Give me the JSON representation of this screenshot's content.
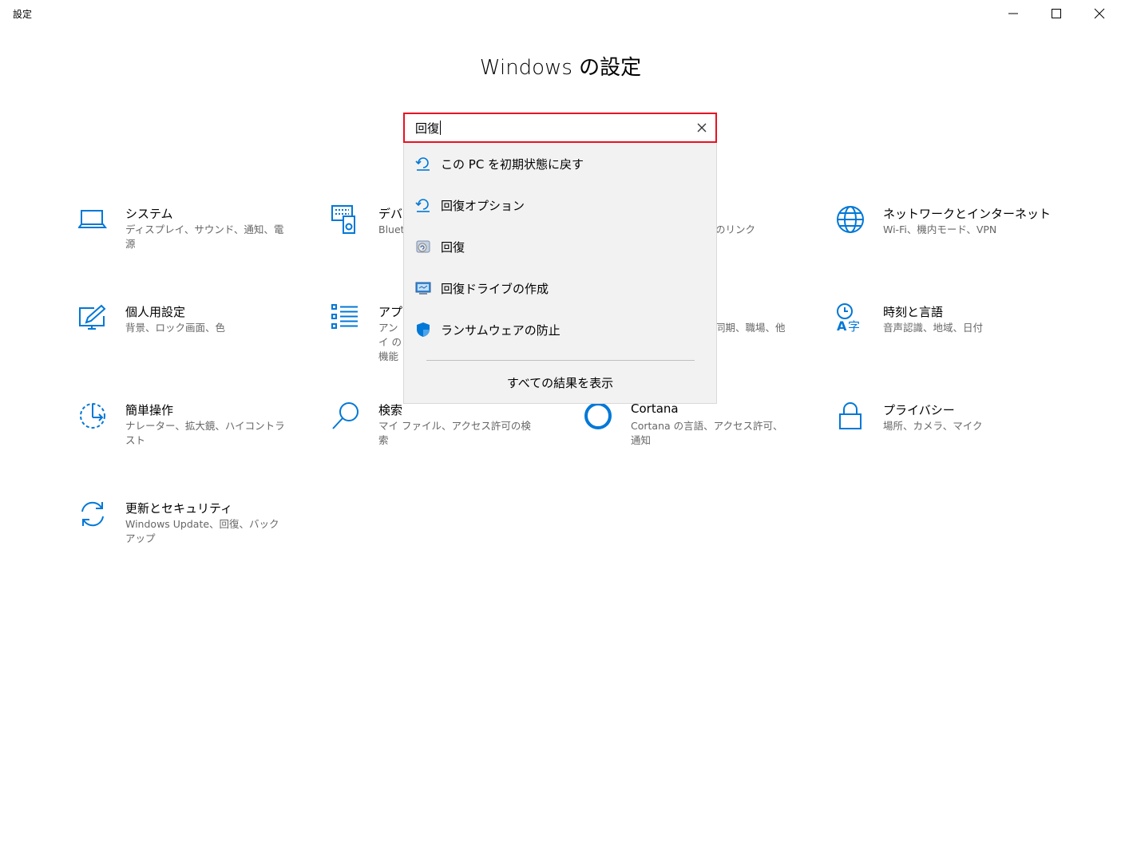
{
  "window": {
    "title": "設定",
    "controls": {
      "minimize_icon": "minimize-icon",
      "maximize_icon": "maximize-icon",
      "close_icon": "close-icon"
    }
  },
  "heading": "Windows の設定",
  "accent_color": "#0078d7",
  "search": {
    "value": "回復",
    "clear_icon": "close-icon",
    "suggestions": [
      {
        "label": "この PC を初期状態に戻す",
        "icon": "recovery-icon"
      },
      {
        "label": "回復オプション",
        "icon": "recovery-icon"
      },
      {
        "label": "回復",
        "icon": "control-panel-recovery-icon"
      },
      {
        "label": "回復ドライブの作成",
        "icon": "recovery-drive-icon"
      },
      {
        "label": "ランサムウェアの防止",
        "icon": "shield-icon"
      }
    ],
    "show_all": "すべての結果を表示"
  },
  "tiles": {
    "system": {
      "title": "システム",
      "desc": "ディスプレイ、サウンド、通知、電源",
      "icon": "laptop-icon"
    },
    "devices": {
      "title": "デバイ",
      "desc": "Bluet",
      "icon": "devices-icon"
    },
    "phone": {
      "desc": "のリンク"
    },
    "network": {
      "title": "ネットワークとインターネット",
      "desc": "Wi-Fi、機内モード、VPN",
      "icon": "globe-icon"
    },
    "personalization": {
      "title": "個人用設定",
      "desc": "背景、ロック画面、色",
      "icon": "paint-icon"
    },
    "apps": {
      "title": "アプリ",
      "desc": "アンイ の機能",
      "icon": "apps-list-icon"
    },
    "accounts": {
      "desc": "同期、職場、他"
    },
    "time": {
      "title": "時刻と言語",
      "desc": "音声認識、地域、日付",
      "icon": "time-language-icon"
    },
    "ease": {
      "title": "簡単操作",
      "desc": "ナレーター、拡大鏡、ハイコントラスト",
      "icon": "ease-of-access-icon"
    },
    "search_tile": {
      "title": "検索",
      "desc": "マイ ファイル、アクセス許可の検索",
      "icon": "search-icon"
    },
    "cortana": {
      "title": "Cortana",
      "desc": "Cortana の言語、アクセス許可、通知",
      "icon": "cortana-icon"
    },
    "privacy": {
      "title": "プライバシー",
      "desc": "場所、カメラ、マイク",
      "icon": "lock-icon"
    },
    "update": {
      "title": "更新とセキュリティ",
      "desc": "Windows Update、回復、バックアップ",
      "icon": "sync-icon"
    }
  }
}
